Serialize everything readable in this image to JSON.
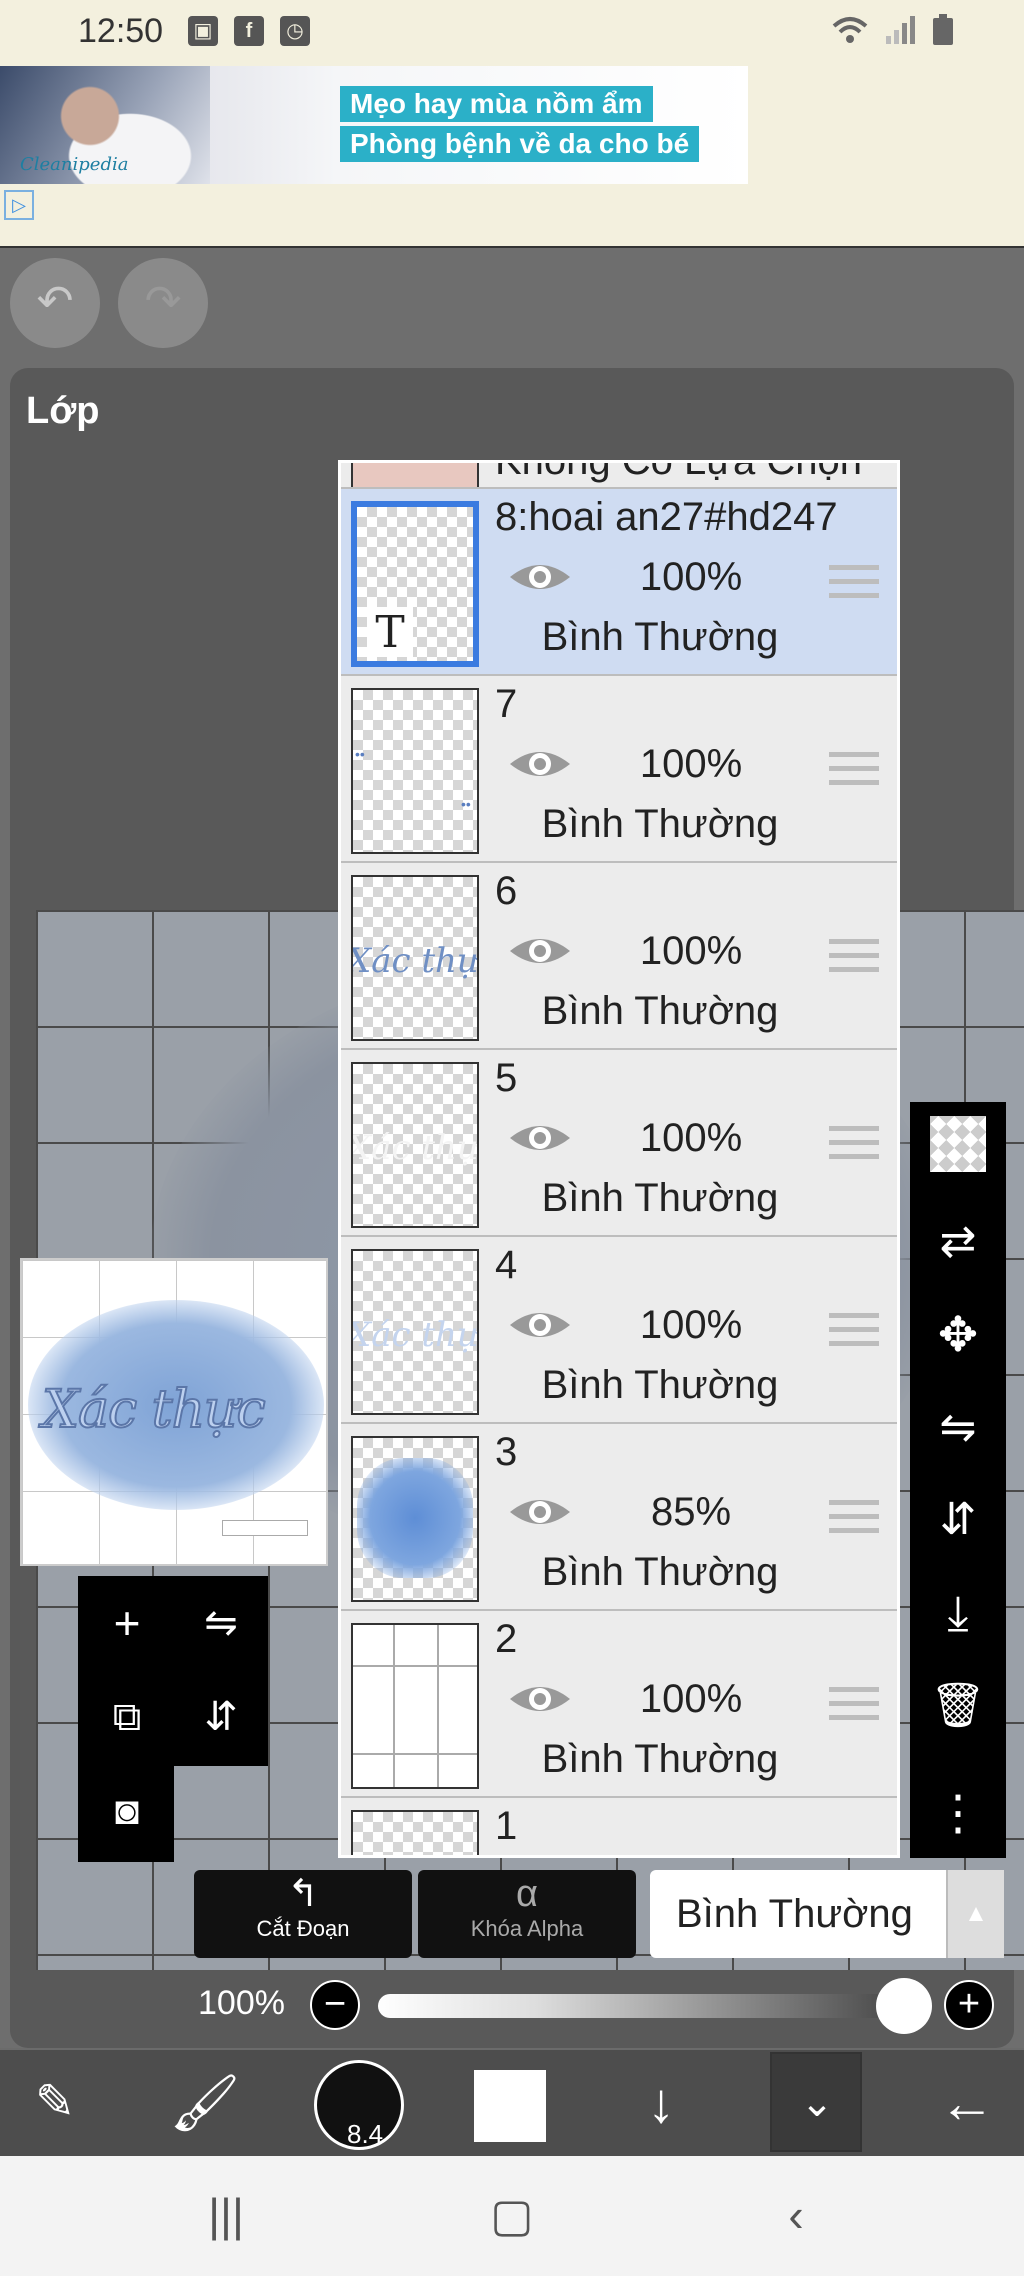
{
  "status_bar": {
    "time": "12:50",
    "icons": [
      "image-icon",
      "facebook-icon",
      "clock-icon"
    ],
    "right_icons": [
      "wifi-icon",
      "signal-icon",
      "battery-icon"
    ]
  },
  "ad": {
    "line1": "Mẹo hay mùa nồm ẩm",
    "line2": "Phòng bệnh về da cho bé",
    "brand": "Cleanipedia"
  },
  "panel": {
    "title": "Lớp"
  },
  "layers": [
    {
      "name": "Không Có Lựa Chọn",
      "partial": true
    },
    {
      "name": "8:hoai an27#hd247",
      "opacity": "100%",
      "mode": "Bình Thường",
      "selected": true,
      "thumb": "text"
    },
    {
      "name": "7",
      "opacity": "100%",
      "mode": "Bình Thường",
      "thumb": "dots"
    },
    {
      "name": "6",
      "opacity": "100%",
      "mode": "Bình Thường",
      "thumb": "script-blue"
    },
    {
      "name": "5",
      "opacity": "100%",
      "mode": "Bình Thường",
      "thumb": "script-white"
    },
    {
      "name": "4",
      "opacity": "100%",
      "mode": "Bình Thường",
      "thumb": "script-light"
    },
    {
      "name": "3",
      "opacity": "85%",
      "mode": "Bình Thường",
      "thumb": "cloud"
    },
    {
      "name": "2",
      "opacity": "100%",
      "mode": "Bình Thường",
      "thumb": "grid"
    },
    {
      "name": "1",
      "partial_bottom": true
    }
  ],
  "preview": {
    "text": "Xác thực"
  },
  "buttons": {
    "cut": "Cắt Đoạn",
    "alpha": "Khóa Alpha",
    "blend_mode": "Bình Thường"
  },
  "opacity_control": {
    "value": "100%",
    "minus": "−",
    "plus": "+",
    "level": 1.0
  },
  "brush_size": "8.4",
  "colors": {
    "selection": "#3b7be0",
    "selected_row": "#cfdcf2",
    "ad_accent": "#2bb0c8"
  }
}
